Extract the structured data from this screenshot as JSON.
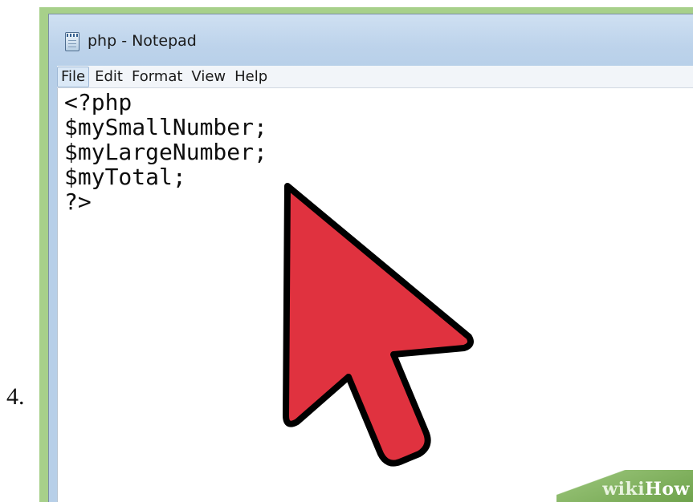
{
  "step": {
    "number": "4."
  },
  "window": {
    "title": "php - Notepad",
    "icon": "notepad-icon"
  },
  "menubar": {
    "items": [
      {
        "label": "File",
        "active": true
      },
      {
        "label": "Edit"
      },
      {
        "label": "Format"
      },
      {
        "label": "View"
      },
      {
        "label": "Help"
      }
    ]
  },
  "editor": {
    "lines": [
      "<?php",
      "$mySmallNumber;",
      "$myLargeNumber;",
      "$myTotal;",
      "?>"
    ]
  },
  "overlay": {
    "pointer_icon": "mouse-pointer-arrow-icon",
    "pointer_color": "#e0323f"
  },
  "watermark": {
    "part1": "wiki",
    "part2": "How"
  }
}
